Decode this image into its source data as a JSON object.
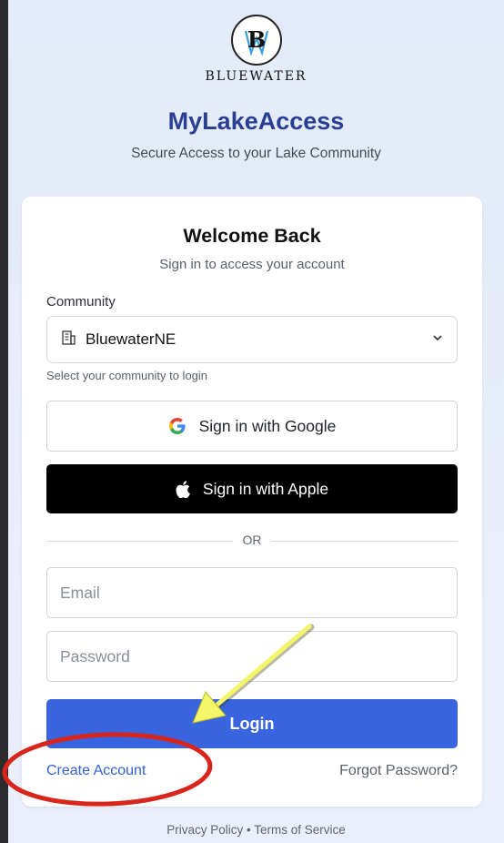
{
  "brand": {
    "logo_monogram": "B",
    "wordmark": "BLUEWATER"
  },
  "header": {
    "title": "MyLakeAccess",
    "subtitle": "Secure Access to your Lake Community"
  },
  "card": {
    "title": "Welcome Back",
    "subtitle": "Sign in to access your account",
    "community": {
      "label": "Community",
      "selected": "BluewaterNE",
      "helper": "Select your community to login"
    },
    "google_label": "Sign in with Google",
    "apple_label": "Sign in with Apple",
    "divider": "OR",
    "email_placeholder": "Email",
    "password_placeholder": "Password",
    "login_label": "Login",
    "create_account": "Create Account",
    "forgot_password": "Forgot Password?"
  },
  "footer": {
    "privacy": "Privacy Policy",
    "separator": "•",
    "terms": "Terms of Service"
  },
  "colors": {
    "title": "#2a3f93",
    "primary": "#3864e0",
    "annotation_arrow": "#f5f56a",
    "annotation_circle": "#d9261c"
  },
  "icons": {
    "community_select": "building-icon",
    "dropdown": "chevron-down-icon",
    "google": "google-icon",
    "apple": "apple-icon"
  }
}
